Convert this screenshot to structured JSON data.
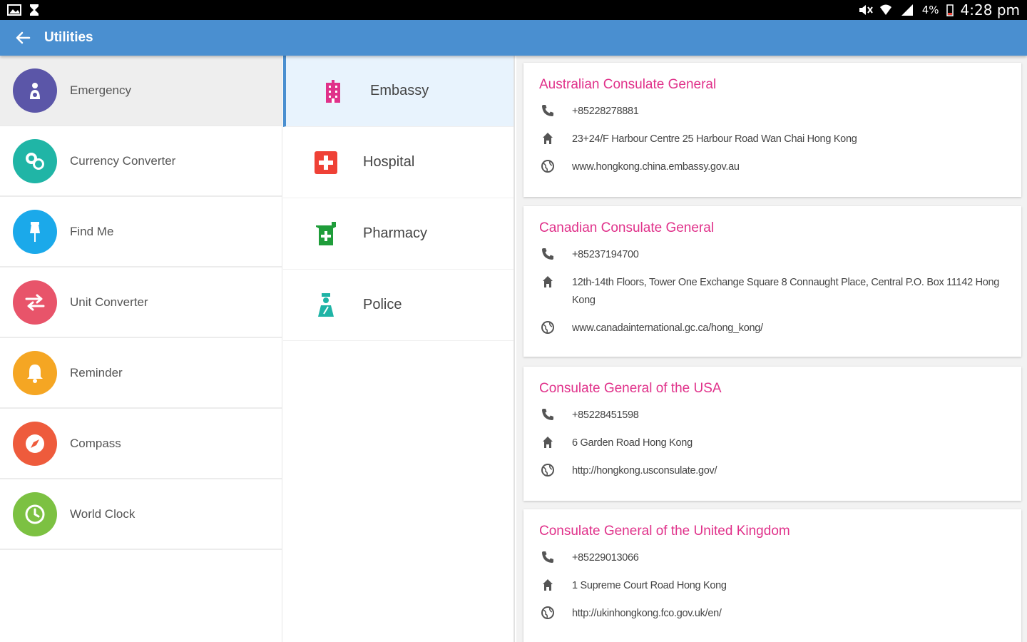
{
  "status_bar": {
    "battery": "4%",
    "time": "4:28 pm",
    "left_icons": [
      "image-icon",
      "hourglass-icon"
    ],
    "right_icons": [
      "mute-icon",
      "wifi-icon",
      "signal-icon",
      "battery-icon"
    ]
  },
  "app_bar": {
    "title": "Utilities",
    "back_icon": "arrow-back-icon",
    "color": "#4a8fd0"
  },
  "utilities": [
    {
      "label": "Emergency",
      "color": "#5b56a8",
      "icon": "emergency-icon"
    },
    {
      "label": "Currency Converter",
      "color": "#20b5a6",
      "icon": "currency-icon"
    },
    {
      "label": "Find Me",
      "color": "#1ba9ea",
      "icon": "pin-icon"
    },
    {
      "label": "Unit Converter",
      "color": "#e8546a",
      "icon": "swap-icon"
    },
    {
      "label": "Reminder",
      "color": "#f5a623",
      "icon": "bell-icon"
    },
    {
      "label": "Compass",
      "color": "#ee5b3c",
      "icon": "compass-icon"
    },
    {
      "label": "World Clock",
      "color": "#7cc142",
      "icon": "clock-icon"
    }
  ],
  "categories": [
    {
      "label": "Embassy",
      "color": "#e0318a",
      "icon": "building-icon"
    },
    {
      "label": "Hospital",
      "color": "#ef4136",
      "icon": "hospital-icon"
    },
    {
      "label": "Pharmacy",
      "color": "#1f9d3a",
      "icon": "pharmacy-icon"
    },
    {
      "label": "Police",
      "color": "#1fb4a6",
      "icon": "police-icon"
    }
  ],
  "consulates": [
    {
      "name": "Australian Consulate General",
      "phone": "+85228278881",
      "address": "23+24/F Harbour Centre 25 Harbour Road Wan Chai Hong Kong",
      "website": "www.hongkong.china.embassy.gov.au"
    },
    {
      "name": "Canadian Consulate General",
      "phone": "+85237194700",
      "address": "12th-14th Floors, Tower One Exchange Square 8 Connaught Place, Central P.O. Box 11142 Hong Kong",
      "website": "www.canadainternational.gc.ca/hong_kong/"
    },
    {
      "name": "Consulate General of the USA",
      "phone": "+85228451598",
      "address": "6 Garden Road Hong Kong",
      "website": "http://hongkong.usconsulate.gov/"
    },
    {
      "name": "Consulate General of the United Kingdom",
      "phone": "+85229013066",
      "address": "1 Supreme Court Road Hong Kong",
      "website": "http://ukinhongkong.fco.gov.uk/en/"
    }
  ],
  "accent_color": "#e0318a"
}
